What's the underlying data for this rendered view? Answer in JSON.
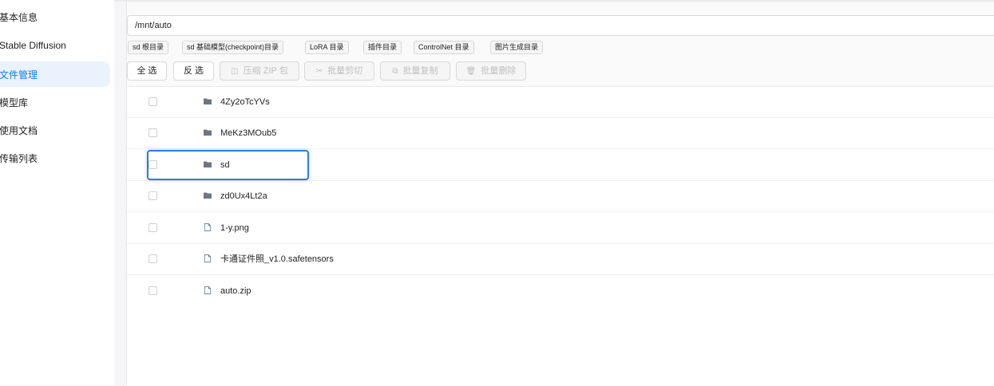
{
  "sidebar": {
    "items": [
      {
        "label": "基本信息"
      },
      {
        "label": "Stable Diffusion"
      },
      {
        "label": "文件管理"
      },
      {
        "label": "模型库"
      },
      {
        "label": "使用文档"
      },
      {
        "label": "传输列表"
      }
    ],
    "active": "文件管理"
  },
  "path": {
    "value": "/mnt/auto"
  },
  "quick_dirs": [
    {
      "label": "sd 根目录"
    },
    {
      "label": "sd 基础模型(checkpoint)目录"
    },
    {
      "label": "LoRA 目录"
    },
    {
      "label": "插件目录"
    },
    {
      "label": "ControlNet 目录"
    },
    {
      "label": "图片生成目录"
    }
  ],
  "toolbar": {
    "select_all": "全 选",
    "invert": "反 选",
    "zip": "压缩 ZIP 包",
    "cut": "批量剪切",
    "copy": "批量复制",
    "delete": "批量删除"
  },
  "files": [
    {
      "name": "4Zy2oTcYVs",
      "type": "folder"
    },
    {
      "name": "MeKz3MOub5",
      "type": "folder"
    },
    {
      "name": "sd",
      "type": "folder"
    },
    {
      "name": "zd0Ux4Lt2a",
      "type": "folder"
    },
    {
      "name": "1-y.png",
      "type": "file"
    },
    {
      "name": "卡通证件照_v1.0.safetensors",
      "type": "file"
    },
    {
      "name": "auto.zip",
      "type": "file"
    }
  ],
  "colors": {
    "accent": "#1677ff",
    "highlight": "#2f7be0",
    "folder": "#6b7785"
  }
}
